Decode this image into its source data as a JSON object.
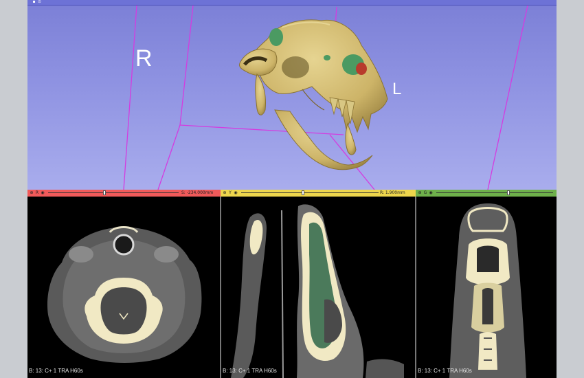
{
  "view3d": {
    "orientation_right": "R",
    "orientation_left": "L",
    "pin_icon": "pin-icon",
    "link_icon": "link-icon"
  },
  "slices": [
    {
      "id": "red",
      "bar_letter": "R",
      "offset": "S: -234.000mm",
      "volume_label": "B: 13: C+ 1 TRA H60s",
      "color": "#f05a5a",
      "slider": 0.43
    },
    {
      "id": "yellow",
      "bar_letter": "Y",
      "offset": "R: 1.900mm",
      "volume_label": "B: 13: C+ 1 TRA H60s",
      "color": "#edd54c",
      "slider": 0.45
    },
    {
      "id": "green",
      "bar_letter": "G",
      "offset": "",
      "volume_label": "B: 13: C+ 1 TRA H60s",
      "color": "#6eb04b",
      "slider": 0.62
    }
  ],
  "colors": {
    "bone": "#d9c47c",
    "bone_dark": "#a68f4a",
    "segment_green": "#4b9a62",
    "segment_red": "#b83b2c",
    "box_edge": "#d43ce0",
    "background_top": "#7b7fd6",
    "background_bottom": "#a9aded"
  }
}
